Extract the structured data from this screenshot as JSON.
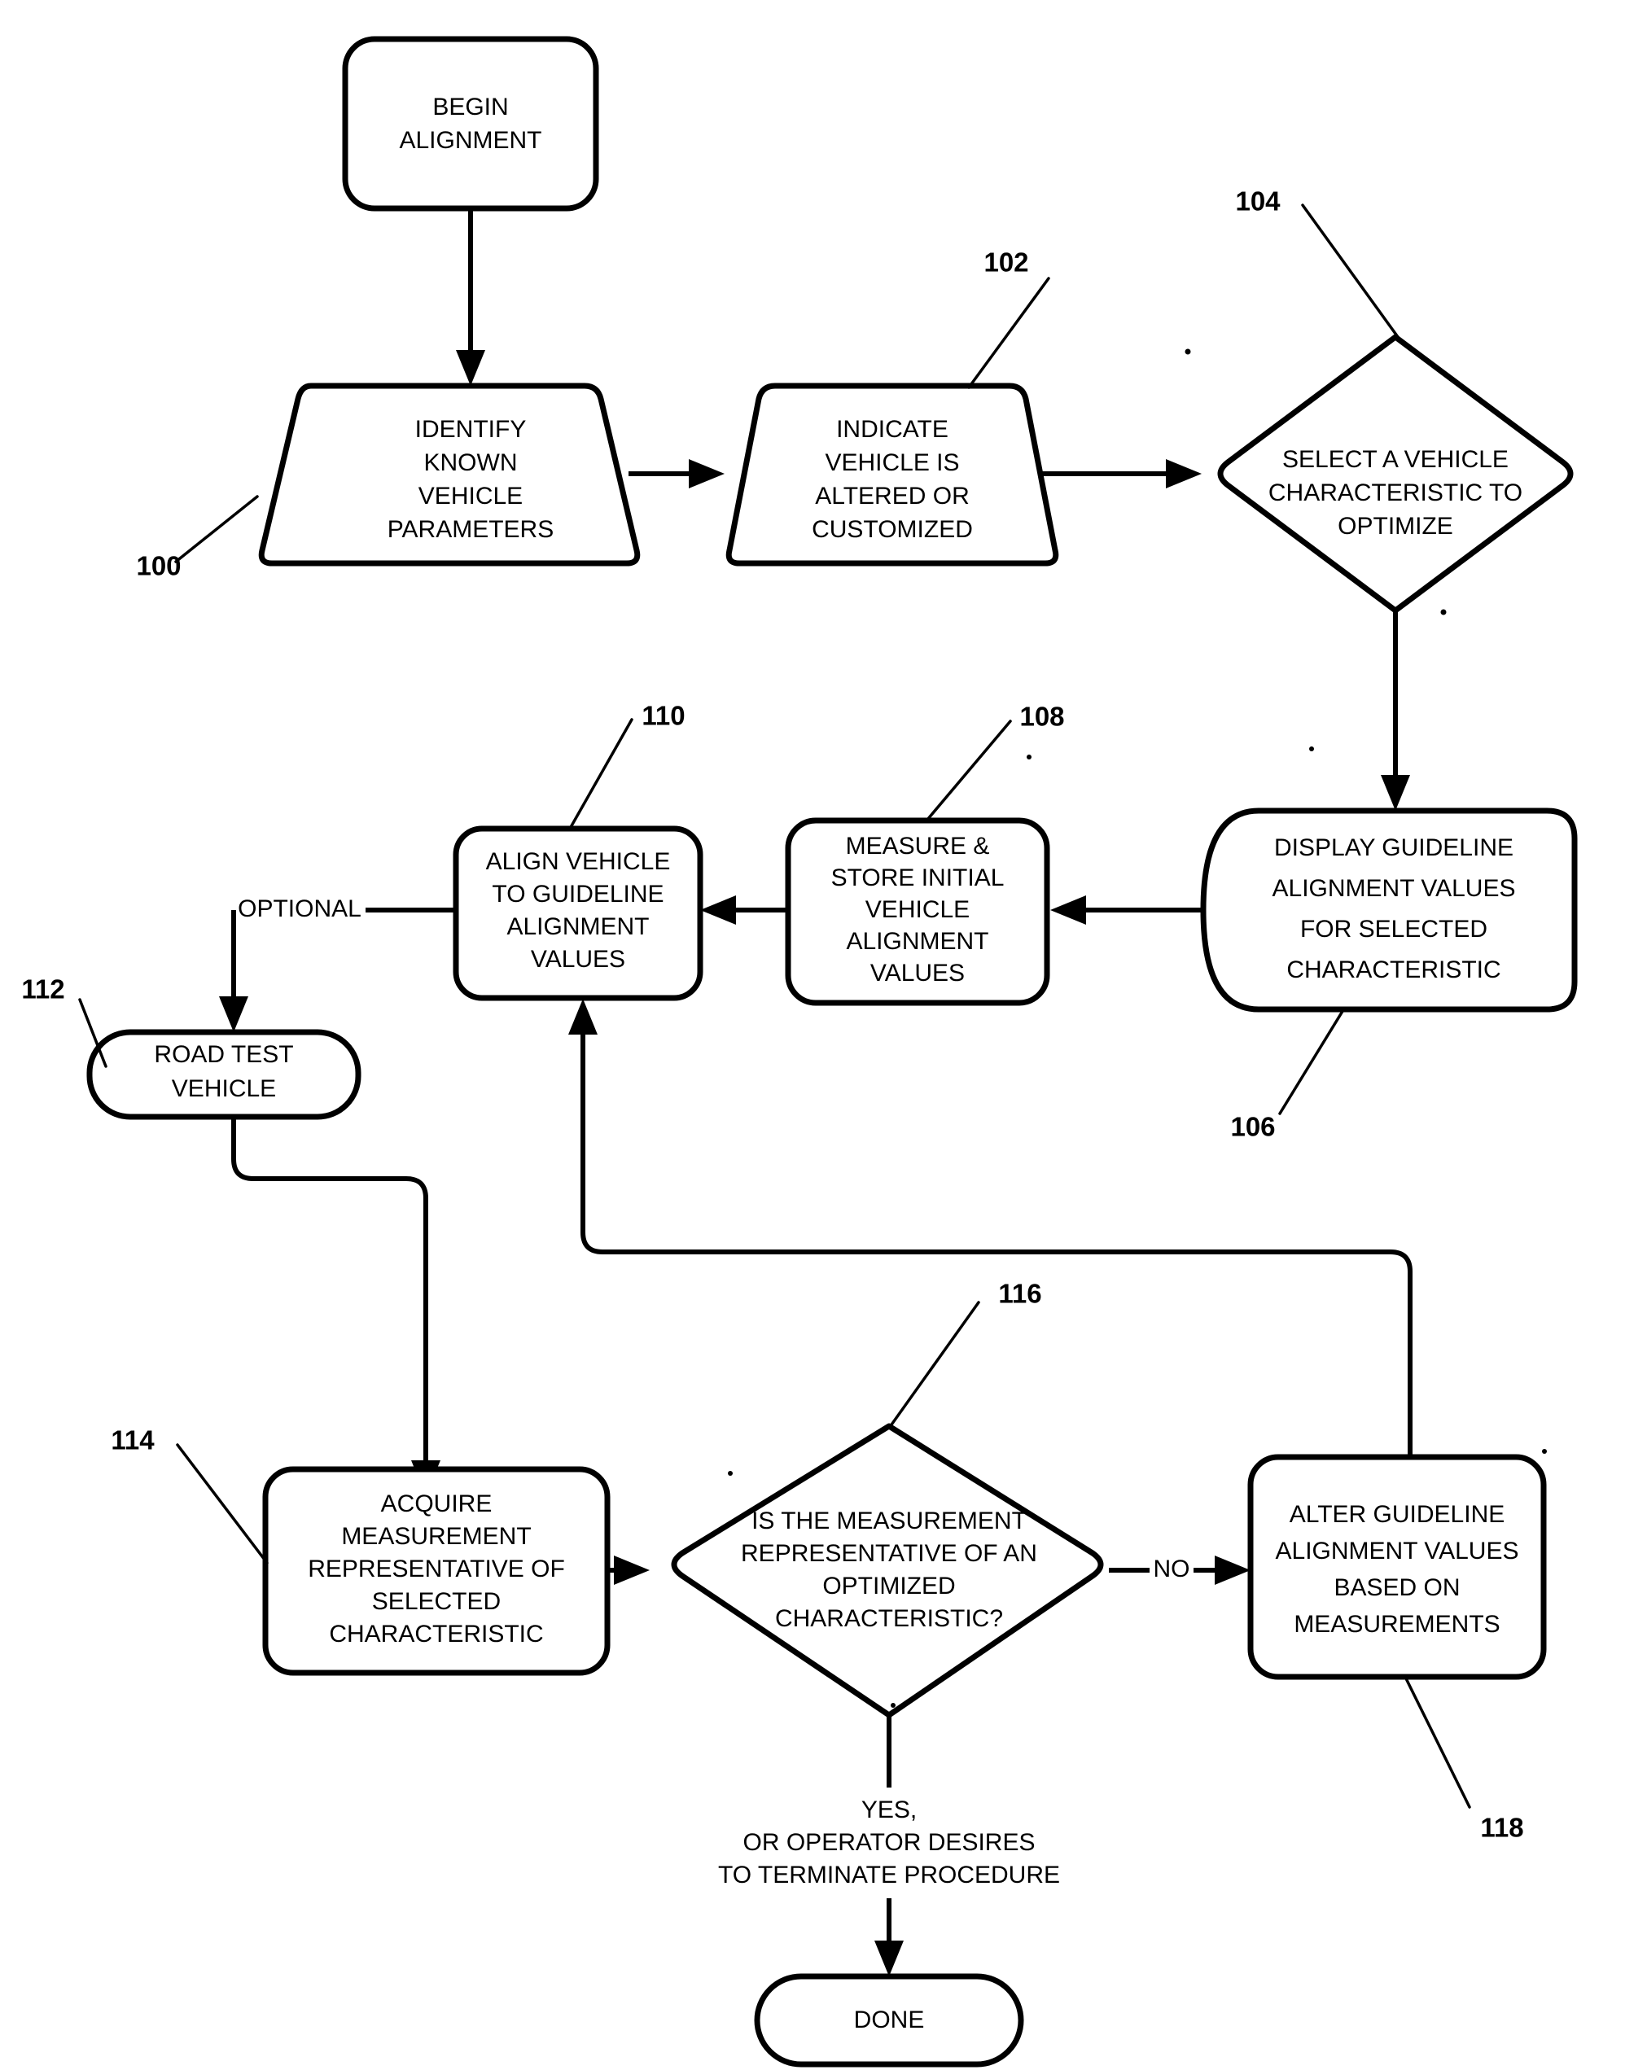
{
  "figure": {
    "type": "flowchart",
    "title": "Vehicle Alignment Optimization Procedure"
  },
  "nodes": {
    "begin": {
      "ref": "",
      "lines": [
        "BEGIN",
        "ALIGNMENT"
      ],
      "shape": "rounded-rect"
    },
    "identify": {
      "ref": "100",
      "lines": [
        "IDENTIFY",
        "KNOWN",
        "VEHICLE",
        "PARAMETERS"
      ],
      "shape": "trapezoid"
    },
    "indicate": {
      "ref": "102",
      "lines": [
        "INDICATE",
        "VEHICLE IS",
        "ALTERED OR",
        "CUSTOMIZED"
      ],
      "shape": "trapezoid"
    },
    "select": {
      "ref": "104",
      "lines": [
        "SELECT A VEHICLE",
        "CHARACTERISTIC TO",
        "OPTIMIZE"
      ],
      "shape": "diamond"
    },
    "display": {
      "ref": "106",
      "lines": [
        "DISPLAY GUIDELINE",
        "ALIGNMENT VALUES",
        "FOR SELECTED",
        "CHARACTERISTIC"
      ],
      "shape": "round-left-rect"
    },
    "measure": {
      "ref": "108",
      "lines": [
        "MEASURE &",
        "STORE INITIAL",
        "VEHICLE",
        "ALIGNMENT",
        "VALUES"
      ],
      "shape": "rounded-rect"
    },
    "align": {
      "ref": "110",
      "lines": [
        "ALIGN VEHICLE",
        "TO GUIDELINE",
        "ALIGNMENT",
        "VALUES"
      ],
      "shape": "rounded-rect"
    },
    "roadtest": {
      "ref": "112",
      "lines": [
        "ROAD TEST",
        "VEHICLE"
      ],
      "shape": "stadium"
    },
    "acquire": {
      "ref": "114",
      "lines": [
        "ACQUIRE",
        "MEASUREMENT",
        "REPRESENTATIVE OF",
        "SELECTED",
        "CHARACTERISTIC"
      ],
      "shape": "rounded-rect"
    },
    "question": {
      "ref": "116",
      "lines": [
        "IS THE MEASUREMENT",
        "REPRESENTATIVE OF AN",
        "OPTIMIZED",
        "CHARACTERISTIC?"
      ],
      "shape": "diamond"
    },
    "alter": {
      "ref": "118",
      "lines": [
        "ALTER GUIDELINE",
        "ALIGNMENT VALUES",
        "BASED ON",
        "MEASUREMENTS"
      ],
      "shape": "rounded-rect"
    },
    "done": {
      "ref": "",
      "lines": [
        "DONE"
      ],
      "shape": "stadium"
    }
  },
  "edge_labels": {
    "optional": "OPTIONAL",
    "no": "NO",
    "yes_terminate": [
      "YES,",
      "OR OPERATOR DESIRES",
      "TO TERMINATE PROCEDURE"
    ]
  },
  "reference_numerals": [
    "100",
    "102",
    "104",
    "106",
    "108",
    "110",
    "112",
    "114",
    "116",
    "118"
  ],
  "colors": {
    "stroke": "#000000",
    "fill": "#ffffff",
    "background": "#ffffff"
  }
}
